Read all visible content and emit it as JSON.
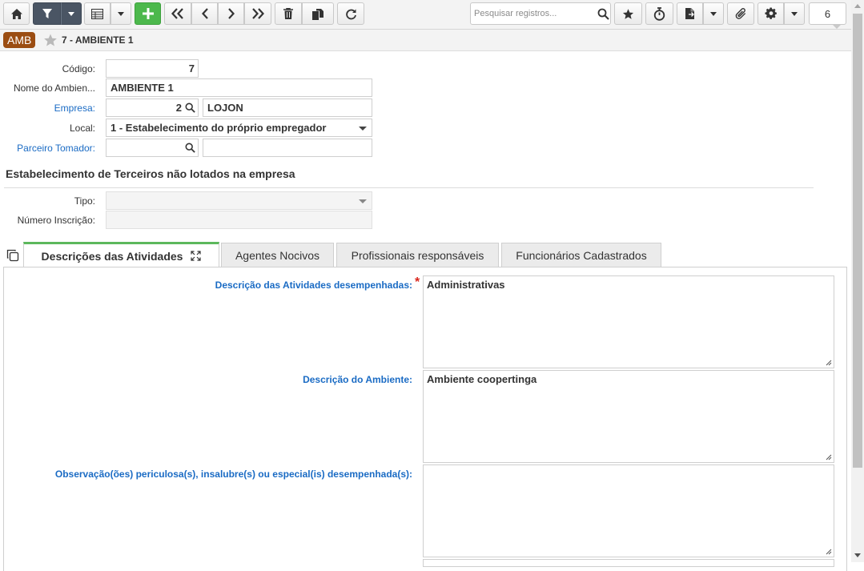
{
  "toolbar": {
    "search_placeholder": "Pesquisar registros...",
    "record_counter": "6",
    "icons": [
      "home-icon",
      "filter-icon",
      "grid-icon",
      "add-icon",
      "first-icon",
      "previous-icon",
      "next-icon",
      "last-icon",
      "delete-icon",
      "duplicate-icon",
      "refresh-icon",
      "search-icon",
      "favorite-icon",
      "timer-icon",
      "report-icon",
      "attach-icon",
      "gear-icon"
    ]
  },
  "header": {
    "badge": "AMB",
    "title": "7 - AMBIENTE 1"
  },
  "form": {
    "codigo_label": "Código:",
    "codigo_value": "7",
    "nome_label": "Nome do Ambien...",
    "nome_value": "AMBIENTE 1",
    "empresa_label": "Empresa:",
    "empresa_code": "2",
    "empresa_name": "LOJON",
    "local_label": "Local:",
    "local_value": "1 - Estabelecimento do próprio empregador",
    "parceiro_label": "Parceiro Tomador:",
    "parceiro_code": "",
    "parceiro_name": ""
  },
  "terceiros": {
    "section_title": "Estabelecimento de Terceiros não lotados na empresa",
    "tipo_label": "Tipo:",
    "tipo_value": "",
    "inscricao_label": "Número Inscrição:",
    "inscricao_value": ""
  },
  "tabs": [
    {
      "label": "Descrições das Atividades",
      "active": true
    },
    {
      "label": "Agentes Nocivos",
      "active": false
    },
    {
      "label": "Profissionais responsáveis",
      "active": false
    },
    {
      "label": "Funcionários Cadastrados",
      "active": false
    }
  ],
  "descricoes": {
    "atividades_label": "Descrição das Atividades desempenhadas:",
    "atividades_required": "*",
    "atividades_value": "Administrativas",
    "ambiente_label": "Descrição do Ambiente:",
    "ambiente_value": "Ambiente coopertinga",
    "observacoes_label": "Observação(ões) periculosa(s), insalubre(s) ou especial(is) desempenhada(s):",
    "observacoes_value": ""
  },
  "colors": {
    "badge": "#9b4d12",
    "link": "#1a6bc4",
    "active_tab_accent": "#5cb85c",
    "add_button": "#4cb84c",
    "filter_button": "#4a5564",
    "required": "#d9261c"
  }
}
